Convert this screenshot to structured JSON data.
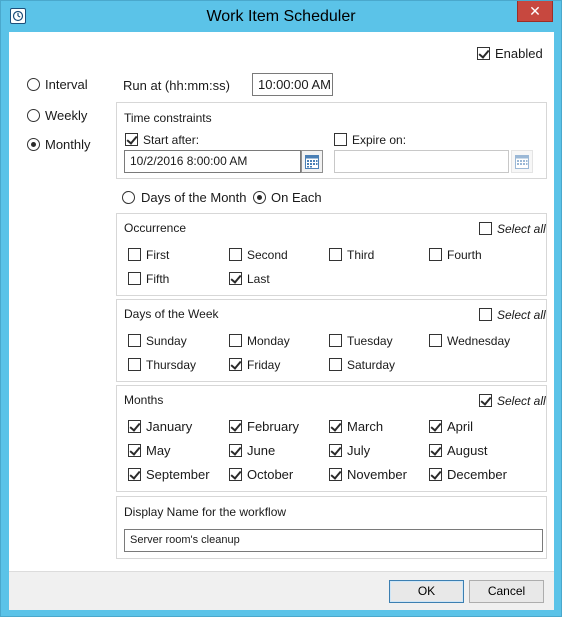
{
  "window": {
    "title": "Work Item Scheduler",
    "close_glyph": "✕",
    "app_icon": "scheduler-icon"
  },
  "enabled": {
    "label": "Enabled",
    "checked": true
  },
  "schedule_type": {
    "options": [
      {
        "label": "Interval",
        "selected": false
      },
      {
        "label": "Weekly",
        "selected": false
      },
      {
        "label": "Monthly",
        "selected": true
      }
    ]
  },
  "run_at": {
    "label": "Run at (hh:mm:ss)",
    "value": "10:00:00 AM"
  },
  "time_constraints": {
    "title": "Time constraints",
    "start_after": {
      "label": "Start after:",
      "checked": true,
      "value": "10/2/2016 8:00:00 AM",
      "icon": "calendar-icon"
    },
    "expire_on": {
      "label": "Expire on:",
      "checked": false,
      "value": "",
      "icon": "calendar-icon"
    }
  },
  "monthly_mode": {
    "options": [
      {
        "label": "Days of the Month",
        "selected": false
      },
      {
        "label": "On Each",
        "selected": true
      }
    ]
  },
  "occurrence": {
    "title": "Occurrence",
    "select_all": {
      "label": "Select all",
      "checked": false
    },
    "items": [
      {
        "label": "First",
        "checked": false
      },
      {
        "label": "Second",
        "checked": false
      },
      {
        "label": "Third",
        "checked": false
      },
      {
        "label": "Fourth",
        "checked": false
      },
      {
        "label": "Fifth",
        "checked": false
      },
      {
        "label": "Last",
        "checked": true
      }
    ]
  },
  "days_of_week": {
    "title": "Days of the Week",
    "select_all": {
      "label": "Select all",
      "checked": false
    },
    "items": [
      {
        "label": "Sunday",
        "checked": false
      },
      {
        "label": "Monday",
        "checked": false
      },
      {
        "label": "Tuesday",
        "checked": false
      },
      {
        "label": "Wednesday",
        "checked": false
      },
      {
        "label": "Thursday",
        "checked": false
      },
      {
        "label": "Friday",
        "checked": true
      },
      {
        "label": "Saturday",
        "checked": false
      }
    ]
  },
  "months": {
    "title": "Months",
    "select_all": {
      "label": "Select all",
      "checked": true
    },
    "items": [
      {
        "label": "January",
        "checked": true
      },
      {
        "label": "February",
        "checked": true
      },
      {
        "label": "March",
        "checked": true
      },
      {
        "label": "April",
        "checked": true
      },
      {
        "label": "May",
        "checked": true
      },
      {
        "label": "June",
        "checked": true
      },
      {
        "label": "July",
        "checked": true
      },
      {
        "label": "August",
        "checked": true
      },
      {
        "label": "September",
        "checked": true
      },
      {
        "label": "October",
        "checked": true
      },
      {
        "label": "November",
        "checked": true
      },
      {
        "label": "December",
        "checked": true
      }
    ]
  },
  "display_name": {
    "title": "Display Name for the workflow",
    "value": "Server room's cleanup"
  },
  "buttons": {
    "ok": "OK",
    "cancel": "Cancel"
  },
  "colors": {
    "title_bar": "#5bc3e8",
    "close_button": "#c7483f",
    "default_button_border": "#3c7fb1"
  }
}
